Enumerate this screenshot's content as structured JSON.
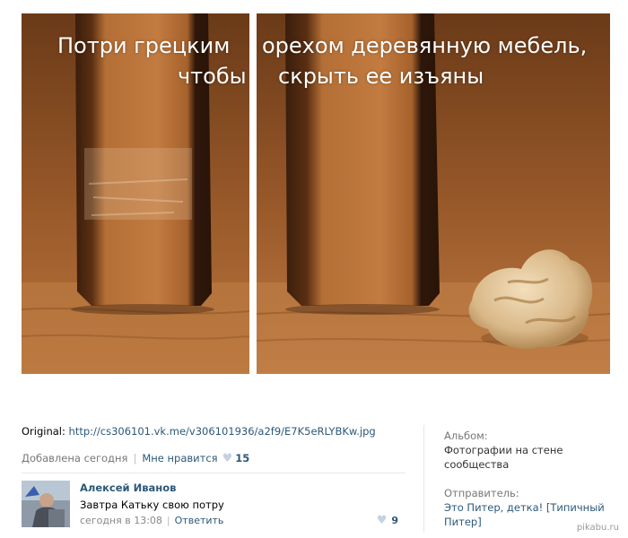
{
  "caption": {
    "line1_left": "Потри грецким",
    "line1_right": "орехом деревянную мебель,",
    "line2_left": "чтобы",
    "line2_right": "скрыть ее изъяны"
  },
  "photo": {
    "left_panel_icon": "chair-leg-scratched-photo",
    "right_panel_icon": "chair-leg-with-walnut-photo"
  },
  "original": {
    "label": "Original:",
    "url": "http://cs306101.vk.me/v306101936/a2f9/E7K5eRLYBKw.jpg"
  },
  "meta": {
    "added": "Добавлена сегодня",
    "like_label": "Мне нравится",
    "like_count": "15"
  },
  "comment": {
    "author": "Алексей Иванов",
    "text": "Завтра Катьку свою потру",
    "time": "сегодня в 13:08",
    "reply_label": "Ответить",
    "likes": "9"
  },
  "side": {
    "album_label": "Альбом:",
    "album_value": "Фотографии на стене сообщества",
    "sender_label": "Отправитель:",
    "sender_value": "Это Питер, детка! [Типичный Питер]"
  },
  "watermark": "pikabu.ru",
  "colors": {
    "link": "#2b587a",
    "wood": "#b36b35",
    "heart": "#c4d2e0"
  }
}
